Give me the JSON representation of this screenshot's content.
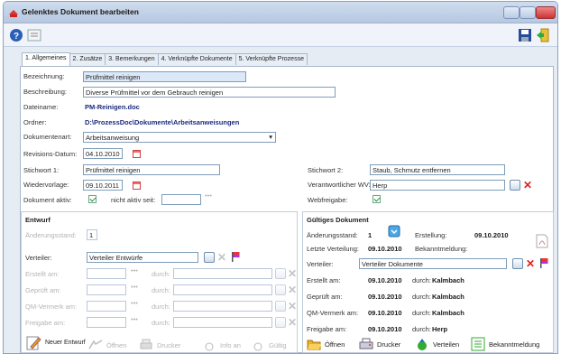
{
  "window": {
    "title": "Gelenktes Dokument bearbeiten",
    "colors": {
      "title_bg": "#b6c8e0",
      "accent": "#1a2a80",
      "close": "#cc3333"
    }
  },
  "toolbar": {
    "left_icons": [
      "help-icon",
      "form-icon"
    ],
    "right_icons": [
      "save-icon",
      "exit-icon"
    ]
  },
  "tabs": [
    {
      "label": "1. Allgemeines",
      "active": true
    },
    {
      "label": "2. Zusätze"
    },
    {
      "label": "3. Bemerkungen"
    },
    {
      "label": "4. Verknüpfte Dokumente"
    },
    {
      "label": "5. Verknüpfte Prozesse"
    }
  ],
  "general": {
    "bezeichnung_label": "Bezeichnung:",
    "bezeichnung_value": "Prüfmittel reinigen",
    "beschreibung_label": "Beschreibung:",
    "beschreibung_value": "Diverse Prüfmittel vor dem Gebrauch reinigen",
    "dateiname_label": "Dateiname:",
    "dateiname_value": "PM-Reinigen.doc",
    "ordner_label": "Ordner:",
    "ordner_value": "D:\\ProzessDoc\\Dokumente\\Arbeitsanweisungen",
    "dokumentenart_label": "Dokumentenart:",
    "dokumentenart_value": "Arbeitsanweisung",
    "revisions_label": "Revisions-Datum:",
    "revisions_value": "04.10.2010",
    "stichwort1_label": "Stichwort 1:",
    "stichwort1_value": "Prüfmittel reinigen",
    "stichwort2_label": "Stichwort 2:",
    "stichwort2_value": "Staub, Schmutz entfernen",
    "wiedervorlage_label": "Wiedervorlage:",
    "wiedervorlage_value": "09.10.2011",
    "verantwortlicher_label": "Verantwortlicher WV:",
    "verantwortlicher_value": "Herp",
    "aktiv_label": "Dokument aktiv:",
    "nicht_aktiv_label": "nicht aktiv seit:",
    "webfreigabe_label": "Webfreigabe:"
  },
  "entwurf": {
    "title": "Entwurf",
    "aenderungsstand_label": "Änderungsstand:",
    "aenderungsstand_value": "1",
    "verteiler_label": "Verteiler:",
    "verteiler_value": "Verteiler Entwürfe",
    "rows": [
      {
        "label": "Erstellt am:",
        "durch": "durch:"
      },
      {
        "label": "Geprüft am:",
        "durch": "durch:"
      },
      {
        "label": "QM-Vermerk am:",
        "durch": "durch:"
      },
      {
        "label": "Freigabe am:",
        "durch": "durch:"
      }
    ],
    "buttons": {
      "neu": "Neuer Entwurf",
      "oeffnen": "Öffnen",
      "drucker": "Drucker",
      "info": "Info an",
      "gueltig": "Gültig"
    }
  },
  "gueltig": {
    "title": "Gültiges Dokument",
    "aenderungsstand_label": "Änderungsstand:",
    "aenderungsstand_value": "1",
    "erstellung_label": "Erstellung:",
    "erstellung_value": "09.10.2010",
    "letzte_label": "Letzte Verteilung:",
    "letzte_value": "09.10.2010",
    "bekannt_label": "Bekanntmeldung:",
    "verteiler_label": "Verteiler:",
    "verteiler_value": "Verteiler Dokumente",
    "rows": [
      {
        "label": "Erstellt am:",
        "date": "09.10.2010",
        "durch": "durch:",
        "name": "Kalmbach"
      },
      {
        "label": "Geprüft am:",
        "date": "09.10.2010",
        "durch": "durch:",
        "name": "Kalmbach"
      },
      {
        "label": "QM-Vermerk am:",
        "date": "09.10.2010",
        "durch": "durch:",
        "name": "Kalmbach"
      },
      {
        "label": "Freigabe am:",
        "date": "09.10.2010",
        "durch": "durch:",
        "name": "Herp"
      }
    ],
    "buttons": {
      "oeffnen": "Öffnen",
      "drucker": "Drucker",
      "verteilen": "Verteilen",
      "bekannt": "Bekanntmeldung"
    }
  }
}
